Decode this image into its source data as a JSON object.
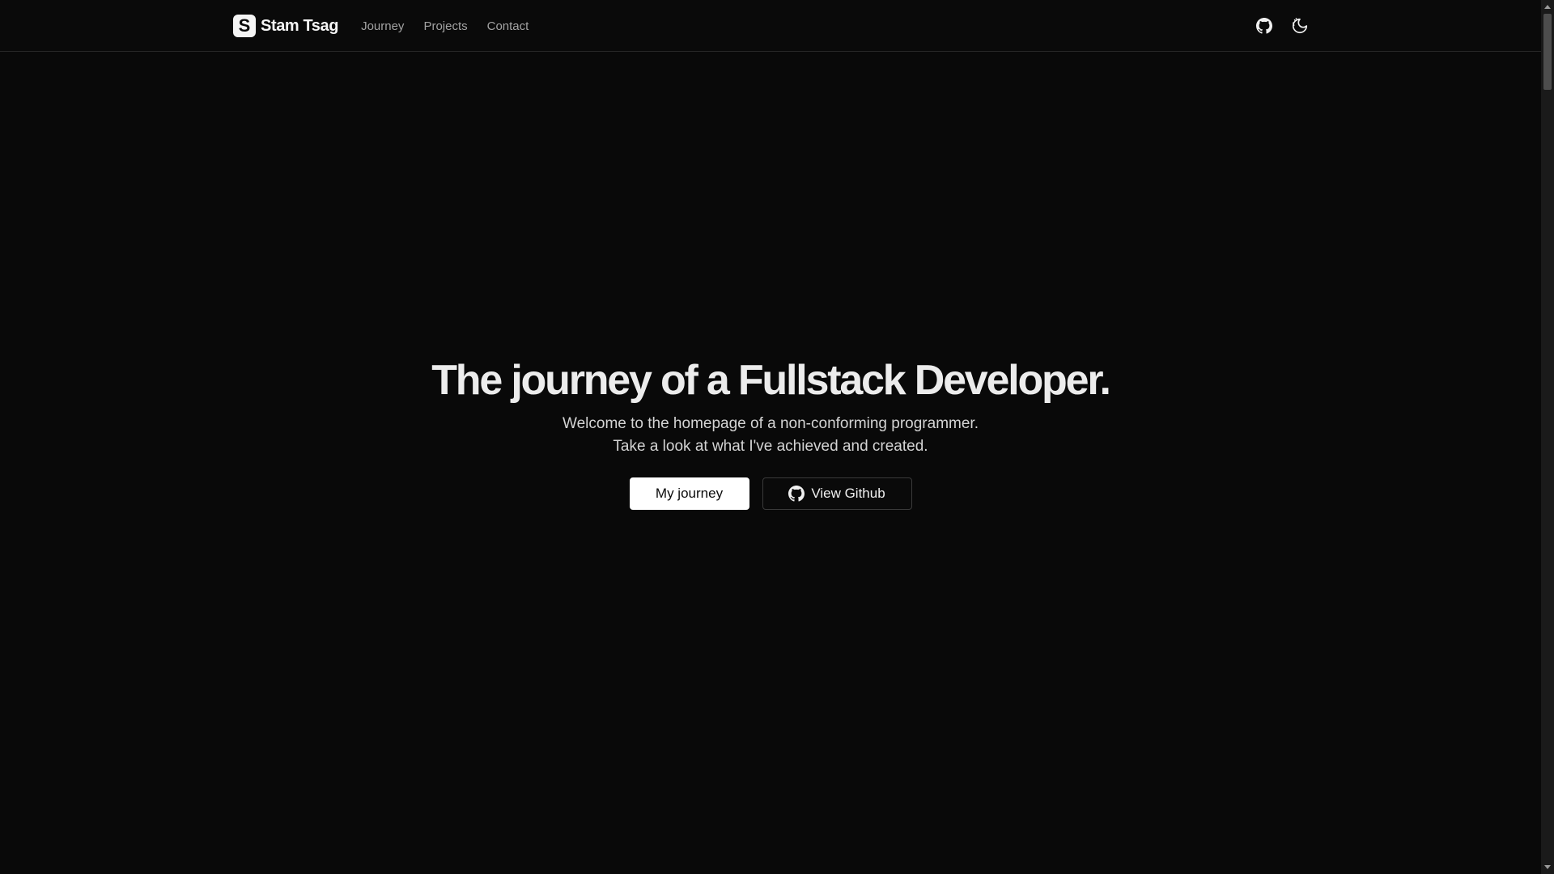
{
  "header": {
    "brand_letter": "S",
    "brand_name": "Stam Tsag",
    "nav": [
      {
        "label": "Journey"
      },
      {
        "label": "Projects"
      },
      {
        "label": "Contact"
      }
    ],
    "actions": [
      {
        "icon": "github-icon"
      },
      {
        "icon": "theme-toggle-icon"
      }
    ]
  },
  "hero": {
    "title": "The journey of a Fullstack Developer.",
    "subtitle": "Welcome to the homepage of a non-conforming programmer. Take a look at what I've achieved and created.",
    "primary_button": "My journey",
    "secondary_button": "View Github"
  },
  "colors": {
    "background": "#090909",
    "text": "#ececec",
    "muted": "#a3a3a3",
    "border": "#262626"
  }
}
